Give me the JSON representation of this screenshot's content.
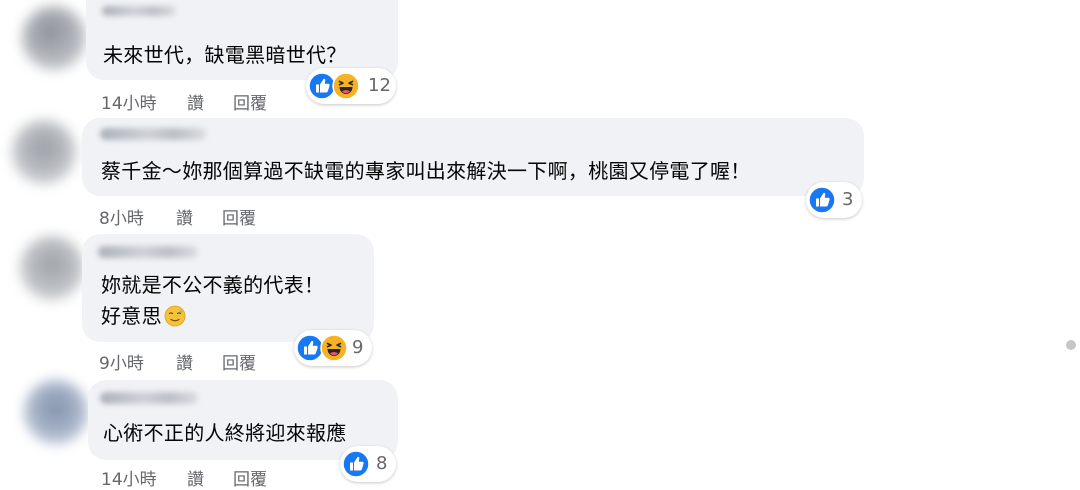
{
  "colors": {
    "bubble": "#f0f2f5",
    "text": "#050505",
    "meta": "#65676b",
    "like_blue": "#1877f2",
    "haha_yellow": "#f7b125"
  },
  "comments": [
    {
      "lines": [
        "未來世代，缺電黑暗世代？"
      ],
      "time": "14小時",
      "like_label": "讚",
      "reply_label": "回覆",
      "reactions": [
        "like-icon",
        "haha-icon"
      ],
      "reaction_count": "12"
    },
    {
      "lines": [
        "蔡千金～妳那個算過不缺電的專家叫出來解決一下啊，桃園又停電了喔！"
      ],
      "time": "8小時",
      "like_label": "讚",
      "reply_label": "回覆",
      "reactions": [
        "like-icon"
      ],
      "reaction_count": "3"
    },
    {
      "lines": [
        "妳就是不公不義的代表！",
        "好意思"
      ],
      "inline_emoji": "sweat-smile-emoji",
      "time": "9小時",
      "like_label": "讚",
      "reply_label": "回覆",
      "reactions": [
        "like-icon",
        "haha-icon"
      ],
      "reaction_count": "9"
    },
    {
      "lines": [
        "心術不正的人終將迎來報應"
      ],
      "time": "14小時",
      "like_label": "讚",
      "reply_label": "回覆",
      "reactions": [
        "like-icon"
      ],
      "reaction_count": "8"
    }
  ]
}
